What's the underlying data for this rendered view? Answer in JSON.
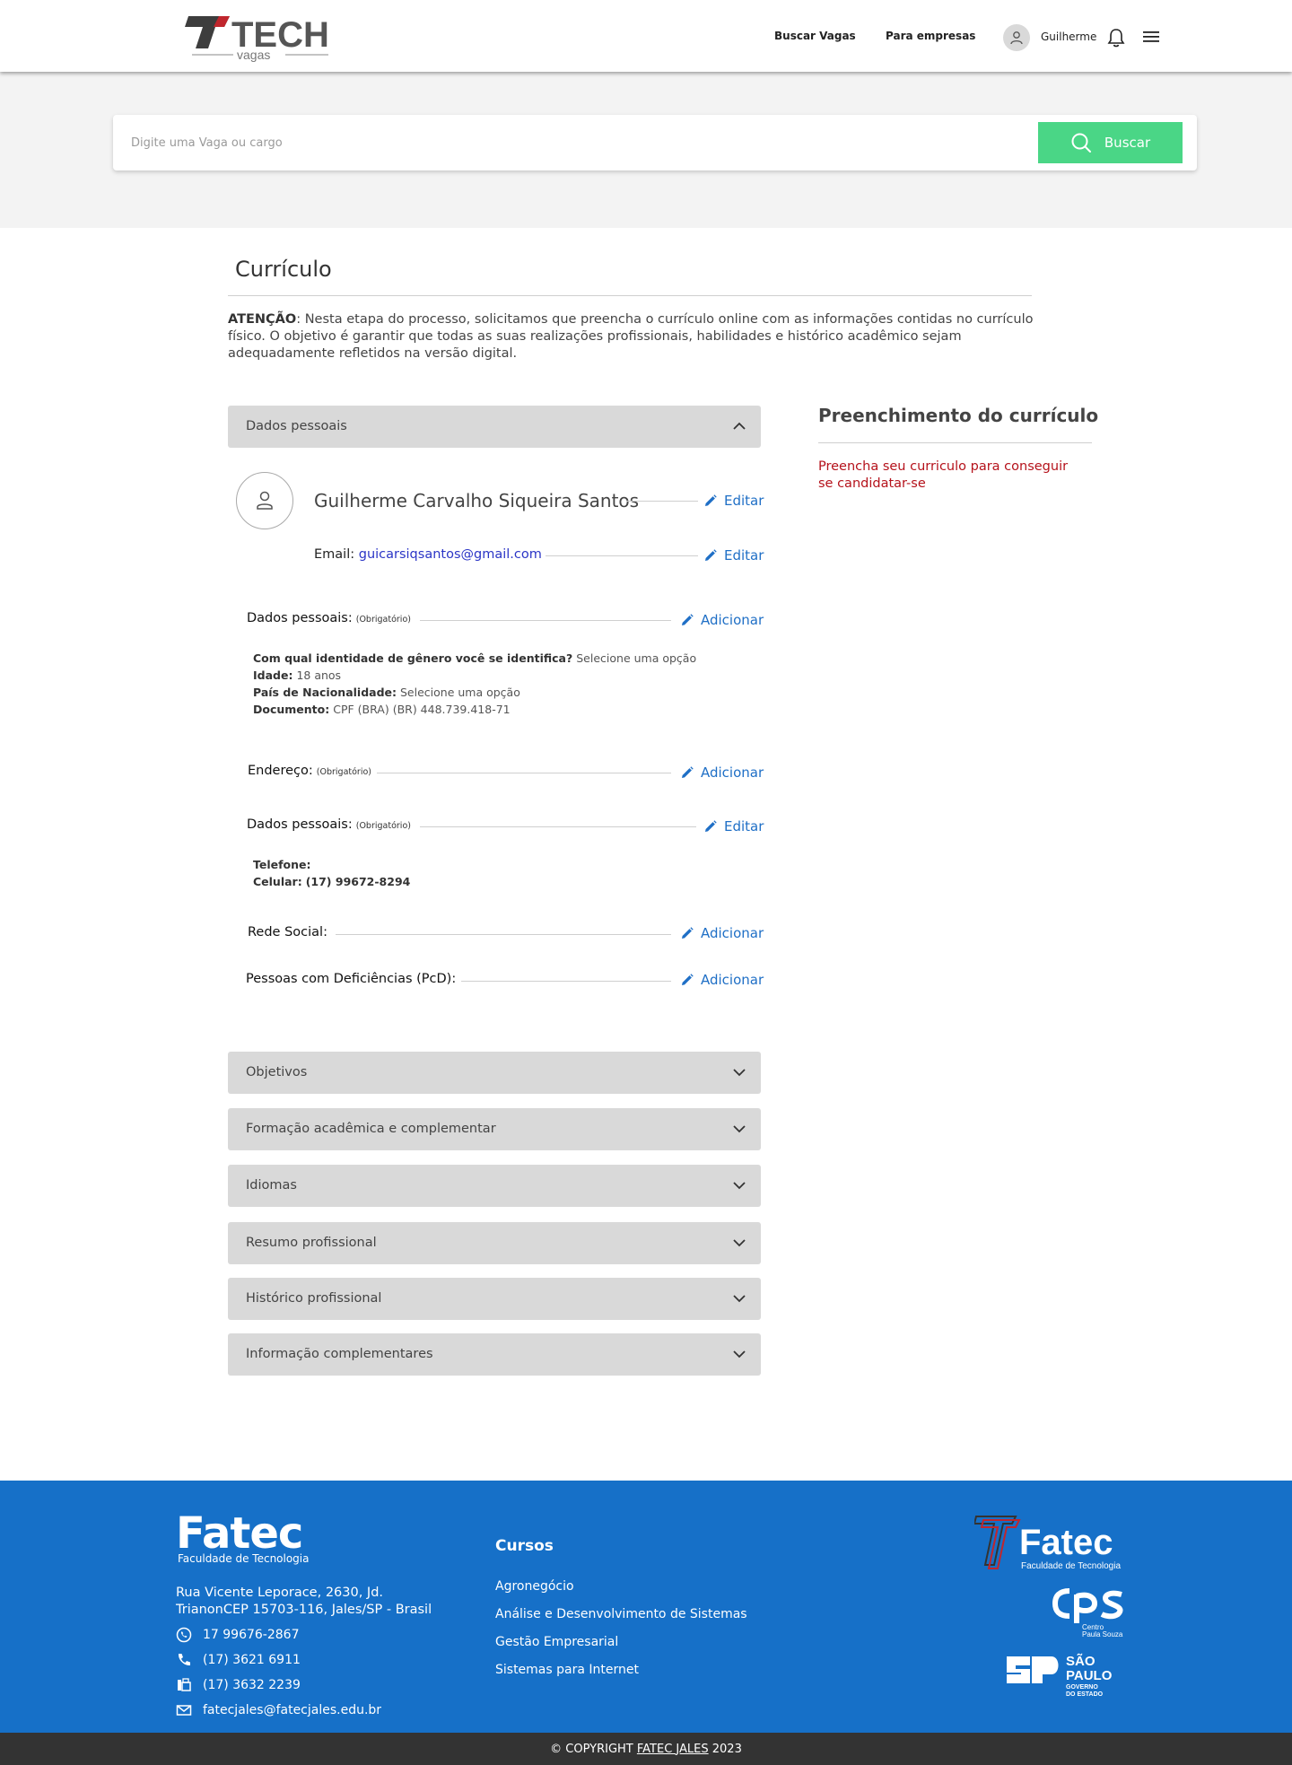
{
  "header": {
    "logo_main": "TECH",
    "logo_sub": "vagas",
    "nav": [
      "Buscar Vagas",
      "Para empresas"
    ],
    "user_name": "Guilherme"
  },
  "search": {
    "placeholder": "Digite uma Vaga ou cargo",
    "button_label": "Buscar",
    "button_color": "#4ad686"
  },
  "page": {
    "title": "Currículo",
    "notice_label": "ATENÇÃO",
    "notice_text": ": Nesta etapa do processo, solicitamos que preencha o currículo online com as informações contidas no currículo físico. O objetivo é garantir que todas as suas realizações profissionais, habilidades e histórico acadêmico sejam adequadamente refletidos na versão digital."
  },
  "personal": {
    "section_title": "Dados pessoais",
    "full_name": "Guilherme Carvalho Siqueira Santos",
    "edit_label": "Editar",
    "add_label": "Adicionar",
    "email_label": "Email:",
    "email_value": "guicarsiqsantos@gmail.com",
    "dados_title": "Dados pessoais:",
    "required": "(Obrigatório)",
    "gender_label": "Com qual identidade de gênero você se identifica?",
    "gender_value": "Selecione uma opção",
    "age_label": "Idade:",
    "age_value": "18 anos",
    "country_label": "País de Nacionalidade:",
    "country_value": "Selecione uma opção",
    "doc_label": "Documento:",
    "doc_value": "CPF (BRA) (BR) 448.739.418-71",
    "address_title": "Endereço:",
    "contact_title": "Dados pessoais:",
    "phone_label": "Telefone:",
    "mobile_label": "Celular:",
    "mobile_value": "(17) 99672-8294",
    "social_title": "Rede Social:",
    "pcd_title": "Pessoas com Deficiências (PcD):"
  },
  "accordions": [
    "Objetivos",
    "Formação acadêmica e complementar",
    "Idiomas",
    "Resumo profissional",
    "Histórico profissional",
    "Informação complementares"
  ],
  "sidebar": {
    "title": "Preenchimento do currículo",
    "warning": "Preencha seu curriculo para conseguir se candidatar-se",
    "warning_color": "#b5121b"
  },
  "footer": {
    "brand": "Fatec",
    "brand_sub": "Faculdade de Tecnologia",
    "address": "Rua Vicente Leporace, 2630, Jd. TrianonCEP 15703-116, Jales/SP - Brasil",
    "whatsapp": "17 99676-2867",
    "phone": "(17) 3621 6911",
    "fax": "(17) 3632 2239",
    "email": "fatecjales@fatecjales.edu.br",
    "courses_title": "Cursos",
    "courses": [
      "Agronegócio",
      "Análise e Desenvolvimento de Sistemas",
      "Gestão Empresarial",
      "Sistemas para Internet"
    ],
    "logo_fatec": "Fatec",
    "logo_fatec_sub": "Faculdade de Tecnologia",
    "logo_cps_sub1": "Centro",
    "logo_cps_sub2": "Paula Souza",
    "logo_sp1": "SÃO",
    "logo_sp2": "PAULO",
    "logo_sp3": "GOVERNO",
    "logo_sp4": "DO ESTADO",
    "color": "#1670c8"
  },
  "copyright": {
    "prefix": "© COPYRIGHT",
    "link": "FATEC JALES",
    "year": "2023"
  }
}
